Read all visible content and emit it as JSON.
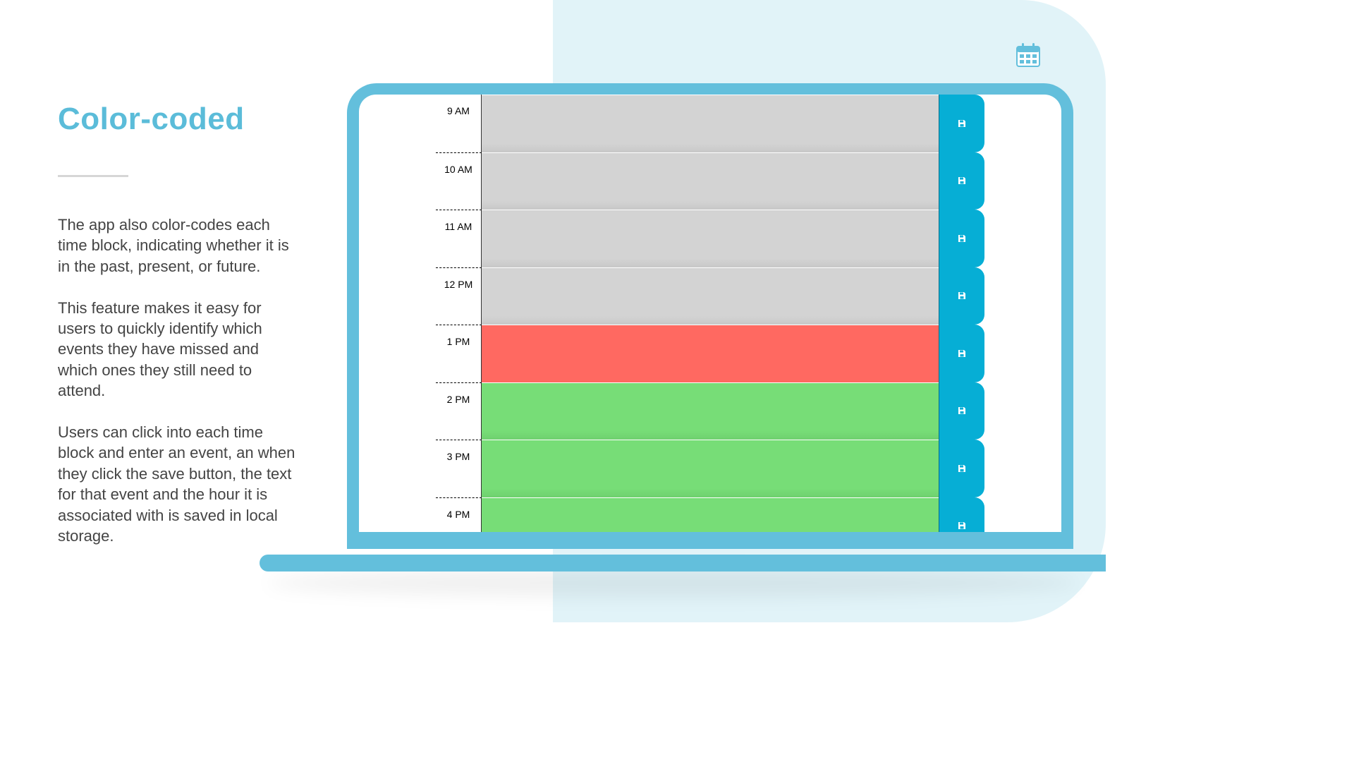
{
  "slide": {
    "heading": "Color-coded",
    "paragraphs": [
      "The app also color-codes each time block, indicating whether it is in the past, present, or future.",
      "This feature makes it easy for users to quickly identify which events they have missed and which ones they still need to attend.",
      "Users can click into each time block and enter an event, an when they click the save button, the text for that event and the hour it is associated with is saved in local storage."
    ],
    "icon": "calendar-icon"
  },
  "planner": {
    "save_icon": "floppy-disk-icon",
    "rows": [
      {
        "hour": "9 AM",
        "state": "past"
      },
      {
        "hour": "10 AM",
        "state": "past"
      },
      {
        "hour": "11 AM",
        "state": "past"
      },
      {
        "hour": "12 PM",
        "state": "past"
      },
      {
        "hour": "1 PM",
        "state": "present"
      },
      {
        "hour": "2 PM",
        "state": "future"
      },
      {
        "hour": "3 PM",
        "state": "future"
      },
      {
        "hour": "4 PM",
        "state": "future"
      }
    ]
  },
  "colors": {
    "accent": "#5bbcd9",
    "past": "#d3d3d3",
    "present": "#ff6961",
    "future": "#77dd77",
    "save": "#06aed5"
  }
}
